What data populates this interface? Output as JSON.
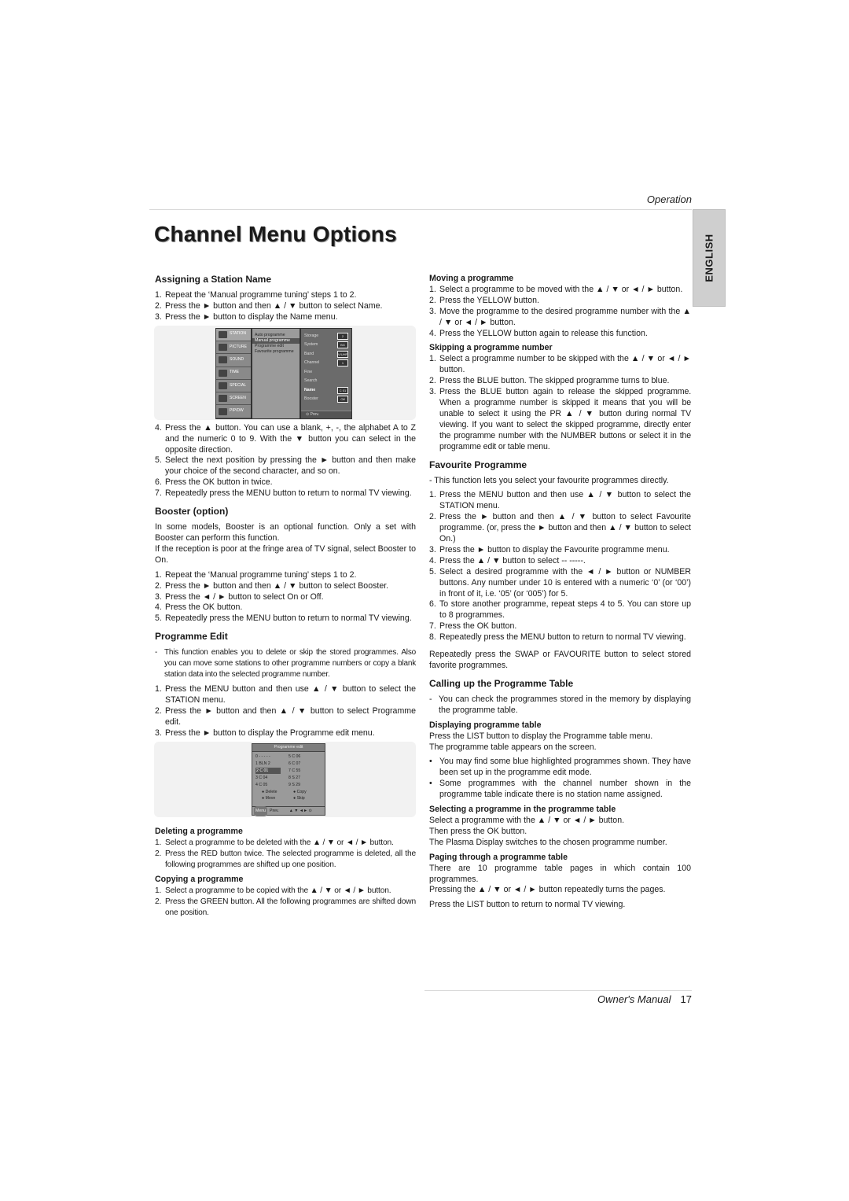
{
  "header": {
    "section": "Operation",
    "language_tab": "ENGLISH",
    "title": "Channel Menu Options"
  },
  "footer": {
    "manual": "Owner's Manual",
    "page_number": "17"
  },
  "assigning": {
    "heading": "Assigning a Station Name",
    "steps_a": [
      {
        "n": "1.",
        "text": "Repeat the ‘Manual programme tuning’ steps 1 to 2."
      },
      {
        "n": "2.",
        "text": "Press the ► button and then ▲ / ▼ button to select Name."
      },
      {
        "n": "3.",
        "text": "Press the ► button to display the Name menu."
      }
    ],
    "steps_b": [
      {
        "n": "4.",
        "text": "Press the ▲ button. You can use a blank, +, -, the alphabet A to Z and the numeric 0 to 9. With the ▼ button you can select in the opposite direction."
      },
      {
        "n": "5.",
        "text": "Select the next position by pressing the ► button and then make your choice of the second character, and so on."
      },
      {
        "n": "6.",
        "text": "Press the OK button in twice."
      },
      {
        "n": "7.",
        "text": "Repeatedly press the MENU button to return to normal TV viewing."
      }
    ]
  },
  "station_osd": {
    "sidebar": [
      "STATION",
      "PICTURE",
      "SOUND",
      "TIME",
      "SPECIAL",
      "SCREEN",
      "PIP/DW"
    ],
    "menu": [
      "Auto programme",
      "Manual programme",
      "Programme edit",
      "Favourite programme"
    ],
    "settings": [
      {
        "label": "Storage",
        "value": "2"
      },
      {
        "label": "System",
        "value": "BG"
      },
      {
        "label": "Band",
        "value": "V/UHF"
      },
      {
        "label": "Channel",
        "value": "1"
      },
      {
        "label": "Fine",
        "value": ""
      },
      {
        "label": "Search",
        "value": ""
      },
      {
        "label": "Name",
        "value": "C 01"
      },
      {
        "label": "Booster",
        "value": "Off"
      }
    ],
    "footer": "Prev."
  },
  "booster": {
    "heading": "Booster (option)",
    "intro1": "In some models, Booster is an optional function. Only a set with Booster can perform this function.",
    "intro2": "If the reception is poor at the fringe area of TV signal, select Booster to On.",
    "steps": [
      {
        "n": "1.",
        "text": "Repeat the ‘Manual programme tuning’ steps 1 to 2."
      },
      {
        "n": "2.",
        "text": "Press the ► button and then ▲ / ▼ button to select Booster."
      },
      {
        "n": "3.",
        "text": "Press the ◄ / ► button to select On or Off."
      },
      {
        "n": "4.",
        "text": "Press the OK button."
      },
      {
        "n": "5.",
        "text": "Repeatedly press the MENU button to return to normal TV viewing."
      }
    ]
  },
  "programme_edit": {
    "heading": "Programme Edit",
    "note": "This function enables you to delete or skip the stored programmes. Also you can move some stations to other programme numbers or copy a blank station data into the selected programme number.",
    "steps": [
      {
        "n": "1.",
        "text": "Press the MENU button and then use ▲ / ▼ button to select the STATION menu."
      },
      {
        "n": "2.",
        "text": "Press the ► button and then ▲ / ▼ button to select Programme edit."
      },
      {
        "n": "3.",
        "text": "Press the ► button to display the Programme edit menu."
      }
    ],
    "osd": {
      "title": "Programme edit",
      "entries": [
        "0 - - - - -",
        "5  C  06",
        "1 BLN 2",
        "6  C  07",
        "2  C  01",
        "7  C  55",
        "3  C  04",
        "8  S  27",
        "4  C  05",
        "9  S  29"
      ],
      "selected_entry": "2  C  01",
      "legend": [
        "● Delete",
        "● Copy",
        "● Move",
        "● Skip"
      ],
      "footer_button": "Menu",
      "footer_label": "Prev.",
      "footer_nav": "▲ ▼ ◄► ⊙"
    },
    "deleting": {
      "heading": "Deleting a programme",
      "steps": [
        {
          "n": "1.",
          "text": "Select a programme to be deleted with the ▲ / ▼ or ◄ / ► button."
        },
        {
          "n": "2.",
          "text": "Press the RED button twice. The selected programme is deleted, all the following programmes are shifted up one position."
        }
      ]
    },
    "copying": {
      "heading": "Copying a programme",
      "steps": [
        {
          "n": "1.",
          "text": "Select a programme to be copied with the ▲ / ▼ or ◄ / ► button."
        },
        {
          "n": "2.",
          "text": "Press the GREEN button. All the following programmes are shifted down one position."
        }
      ]
    }
  },
  "moving": {
    "heading": "Moving a programme",
    "steps": [
      {
        "n": "1.",
        "text": "Select a programme to be moved with the ▲ / ▼ or ◄ / ► button."
      },
      {
        "n": "2.",
        "text": "Press the YELLOW button."
      },
      {
        "n": "3.",
        "text": "Move the programme to the desired programme number with the ▲ / ▼ or ◄ / ► button."
      },
      {
        "n": "4.",
        "text": "Press the YELLOW button again to release this function."
      }
    ]
  },
  "skipping": {
    "heading": "Skipping a programme number",
    "steps": [
      {
        "n": "1.",
        "text": "Select a programme number to be skipped with the ▲ / ▼ or ◄ / ► button."
      },
      {
        "n": "2.",
        "text": "Press the BLUE button. The skipped programme turns to blue."
      },
      {
        "n": "3.",
        "text": "Press the BLUE button again to release the skipped programme. When a programme number is skipped it means that you will be unable to select it using the PR ▲ / ▼ button during normal TV viewing. If you want to select the skipped programme, directly enter the programme number with the NUMBER buttons or select it in the programme edit or table menu."
      }
    ]
  },
  "favourite": {
    "heading": "Favourite Programme",
    "note": "- This function lets you select your favourite programmes directly.",
    "steps": [
      {
        "n": "1.",
        "text": "Press the MENU button and then use ▲ / ▼ button to select the STATION menu."
      },
      {
        "n": "2.",
        "text": "Press the ► button and then ▲ / ▼ button to select Favourite programme. (or, press the ► button and then ▲ / ▼ button to select On.)"
      },
      {
        "n": "3.",
        "text": "Press the ► button to display the Favourite programme menu."
      },
      {
        "n": "4.",
        "text": "Press the ▲ / ▼ button to select -- -----."
      },
      {
        "n": "5.",
        "text": "Select a desired programme with the ◄ / ► button or NUMBER buttons. Any number under 10 is entered with a numeric ‘0’ (or ‘00’) in front of it, i.e. ‘05’ (or ‘005’) for 5."
      },
      {
        "n": "6.",
        "text": "To store another programme, repeat steps 4 to 5. You can store up to 8 programmes."
      },
      {
        "n": "7.",
        "text": "Press the OK button."
      },
      {
        "n": "8.",
        "text": "Repeatedly press the MENU button to return to normal TV viewing."
      }
    ],
    "outro": "Repeatedly press the SWAP or FAVOURITE button to select stored favorite programmes."
  },
  "table": {
    "heading": "Calling up the Programme Table",
    "note": "You can check the programmes stored in the memory by displaying the programme table.",
    "displaying": {
      "heading": "Displaying programme table",
      "line1": "Press the LIST button to display the Programme table menu.",
      "line2": "The programme table appears on the screen.",
      "bullets": [
        "You may find some blue highlighted programmes shown. They have been set up in the programme edit mode.",
        "Some programmes with the channel number shown in the programme table indicate there is no station name assigned."
      ]
    },
    "selecting": {
      "heading": "Selecting a programme in the programme table",
      "line1": "Select a programme with the ▲ / ▼ or ◄ / ► button.",
      "line2": "Then press the OK button.",
      "line3": "The Plasma Display switches to the chosen programme number."
    },
    "paging": {
      "heading": "Paging through a programme table",
      "line1": "There are 10 programme table pages in which contain 100 programmes.",
      "line2": "Pressing the ▲ / ▼ or ◄ / ► button repeatedly turns the pages."
    },
    "outro": "Press the LIST button to return to normal TV viewing."
  }
}
